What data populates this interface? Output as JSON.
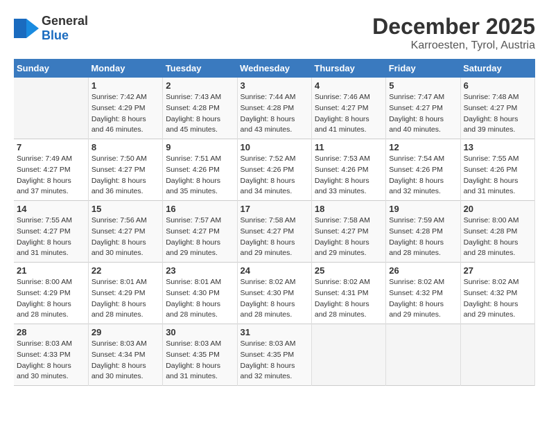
{
  "header": {
    "logo_general": "General",
    "logo_blue": "Blue",
    "month": "December 2025",
    "location": "Karroesten, Tyrol, Austria"
  },
  "weekdays": [
    "Sunday",
    "Monday",
    "Tuesday",
    "Wednesday",
    "Thursday",
    "Friday",
    "Saturday"
  ],
  "weeks": [
    [
      {
        "day": "",
        "sunrise": "",
        "sunset": "",
        "daylight": ""
      },
      {
        "day": "1",
        "sunrise": "Sunrise: 7:42 AM",
        "sunset": "Sunset: 4:29 PM",
        "daylight": "Daylight: 8 hours and 46 minutes."
      },
      {
        "day": "2",
        "sunrise": "Sunrise: 7:43 AM",
        "sunset": "Sunset: 4:28 PM",
        "daylight": "Daylight: 8 hours and 45 minutes."
      },
      {
        "day": "3",
        "sunrise": "Sunrise: 7:44 AM",
        "sunset": "Sunset: 4:28 PM",
        "daylight": "Daylight: 8 hours and 43 minutes."
      },
      {
        "day": "4",
        "sunrise": "Sunrise: 7:46 AM",
        "sunset": "Sunset: 4:27 PM",
        "daylight": "Daylight: 8 hours and 41 minutes."
      },
      {
        "day": "5",
        "sunrise": "Sunrise: 7:47 AM",
        "sunset": "Sunset: 4:27 PM",
        "daylight": "Daylight: 8 hours and 40 minutes."
      },
      {
        "day": "6",
        "sunrise": "Sunrise: 7:48 AM",
        "sunset": "Sunset: 4:27 PM",
        "daylight": "Daylight: 8 hours and 39 minutes."
      }
    ],
    [
      {
        "day": "7",
        "sunrise": "Sunrise: 7:49 AM",
        "sunset": "Sunset: 4:27 PM",
        "daylight": "Daylight: 8 hours and 37 minutes."
      },
      {
        "day": "8",
        "sunrise": "Sunrise: 7:50 AM",
        "sunset": "Sunset: 4:27 PM",
        "daylight": "Daylight: 8 hours and 36 minutes."
      },
      {
        "day": "9",
        "sunrise": "Sunrise: 7:51 AM",
        "sunset": "Sunset: 4:26 PM",
        "daylight": "Daylight: 8 hours and 35 minutes."
      },
      {
        "day": "10",
        "sunrise": "Sunrise: 7:52 AM",
        "sunset": "Sunset: 4:26 PM",
        "daylight": "Daylight: 8 hours and 34 minutes."
      },
      {
        "day": "11",
        "sunrise": "Sunrise: 7:53 AM",
        "sunset": "Sunset: 4:26 PM",
        "daylight": "Daylight: 8 hours and 33 minutes."
      },
      {
        "day": "12",
        "sunrise": "Sunrise: 7:54 AM",
        "sunset": "Sunset: 4:26 PM",
        "daylight": "Daylight: 8 hours and 32 minutes."
      },
      {
        "day": "13",
        "sunrise": "Sunrise: 7:55 AM",
        "sunset": "Sunset: 4:26 PM",
        "daylight": "Daylight: 8 hours and 31 minutes."
      }
    ],
    [
      {
        "day": "14",
        "sunrise": "Sunrise: 7:55 AM",
        "sunset": "Sunset: 4:27 PM",
        "daylight": "Daylight: 8 hours and 31 minutes."
      },
      {
        "day": "15",
        "sunrise": "Sunrise: 7:56 AM",
        "sunset": "Sunset: 4:27 PM",
        "daylight": "Daylight: 8 hours and 30 minutes."
      },
      {
        "day": "16",
        "sunrise": "Sunrise: 7:57 AM",
        "sunset": "Sunset: 4:27 PM",
        "daylight": "Daylight: 8 hours and 29 minutes."
      },
      {
        "day": "17",
        "sunrise": "Sunrise: 7:58 AM",
        "sunset": "Sunset: 4:27 PM",
        "daylight": "Daylight: 8 hours and 29 minutes."
      },
      {
        "day": "18",
        "sunrise": "Sunrise: 7:58 AM",
        "sunset": "Sunset: 4:27 PM",
        "daylight": "Daylight: 8 hours and 29 minutes."
      },
      {
        "day": "19",
        "sunrise": "Sunrise: 7:59 AM",
        "sunset": "Sunset: 4:28 PM",
        "daylight": "Daylight: 8 hours and 28 minutes."
      },
      {
        "day": "20",
        "sunrise": "Sunrise: 8:00 AM",
        "sunset": "Sunset: 4:28 PM",
        "daylight": "Daylight: 8 hours and 28 minutes."
      }
    ],
    [
      {
        "day": "21",
        "sunrise": "Sunrise: 8:00 AM",
        "sunset": "Sunset: 4:29 PM",
        "daylight": "Daylight: 8 hours and 28 minutes."
      },
      {
        "day": "22",
        "sunrise": "Sunrise: 8:01 AM",
        "sunset": "Sunset: 4:29 PM",
        "daylight": "Daylight: 8 hours and 28 minutes."
      },
      {
        "day": "23",
        "sunrise": "Sunrise: 8:01 AM",
        "sunset": "Sunset: 4:30 PM",
        "daylight": "Daylight: 8 hours and 28 minutes."
      },
      {
        "day": "24",
        "sunrise": "Sunrise: 8:02 AM",
        "sunset": "Sunset: 4:30 PM",
        "daylight": "Daylight: 8 hours and 28 minutes."
      },
      {
        "day": "25",
        "sunrise": "Sunrise: 8:02 AM",
        "sunset": "Sunset: 4:31 PM",
        "daylight": "Daylight: 8 hours and 28 minutes."
      },
      {
        "day": "26",
        "sunrise": "Sunrise: 8:02 AM",
        "sunset": "Sunset: 4:32 PM",
        "daylight": "Daylight: 8 hours and 29 minutes."
      },
      {
        "day": "27",
        "sunrise": "Sunrise: 8:02 AM",
        "sunset": "Sunset: 4:32 PM",
        "daylight": "Daylight: 8 hours and 29 minutes."
      }
    ],
    [
      {
        "day": "28",
        "sunrise": "Sunrise: 8:03 AM",
        "sunset": "Sunset: 4:33 PM",
        "daylight": "Daylight: 8 hours and 30 minutes."
      },
      {
        "day": "29",
        "sunrise": "Sunrise: 8:03 AM",
        "sunset": "Sunset: 4:34 PM",
        "daylight": "Daylight: 8 hours and 30 minutes."
      },
      {
        "day": "30",
        "sunrise": "Sunrise: 8:03 AM",
        "sunset": "Sunset: 4:35 PM",
        "daylight": "Daylight: 8 hours and 31 minutes."
      },
      {
        "day": "31",
        "sunrise": "Sunrise: 8:03 AM",
        "sunset": "Sunset: 4:35 PM",
        "daylight": "Daylight: 8 hours and 32 minutes."
      },
      {
        "day": "",
        "sunrise": "",
        "sunset": "",
        "daylight": ""
      },
      {
        "day": "",
        "sunrise": "",
        "sunset": "",
        "daylight": ""
      },
      {
        "day": "",
        "sunrise": "",
        "sunset": "",
        "daylight": ""
      }
    ]
  ]
}
